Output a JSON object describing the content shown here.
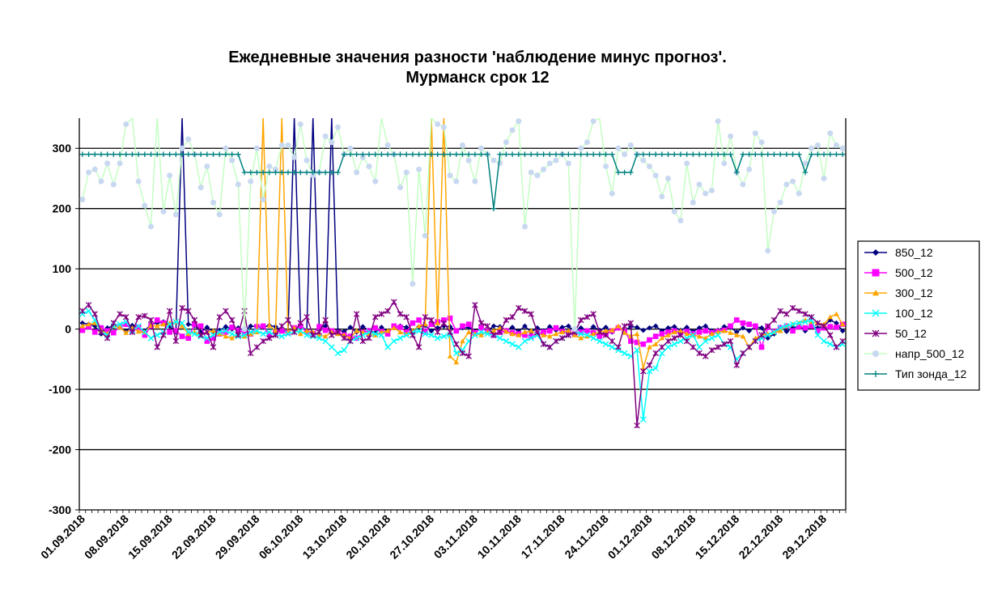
{
  "chart_data": {
    "type": "line",
    "title": [
      "Ежедневные значения разности 'наблюдение минус прогноз'.",
      "Мурманск     срок 12"
    ],
    "xlabel": "",
    "ylabel": "",
    "ylim": [
      -300,
      350
    ],
    "yticks": [
      -300,
      -200,
      -100,
      0,
      100,
      200,
      300
    ],
    "x_start": "2018-09-01",
    "n_days": 123,
    "xtick_labels": [
      "01.09.2018",
      "08.09.2018",
      "15.09.2018",
      "22.09.2018",
      "29.09.2018",
      "06.10.2018",
      "13.10.2018",
      "20.10.2018",
      "27.10.2018",
      "03.11.2018",
      "10.11.2018",
      "17.11.2018",
      "24.11.2018",
      "01.12.2018",
      "08.12.2018",
      "15.12.2018",
      "22.12.2018",
      "29.12.2018"
    ],
    "grid": "horizontal",
    "legend_position": "right",
    "series": [
      {
        "name": "850_12",
        "color": "#000080",
        "marker": "diamond",
        "values": [
          10,
          8,
          5,
          -8,
          2,
          5,
          3,
          -4,
          6,
          2,
          -3,
          8,
          10,
          12,
          5,
          -5,
          350,
          8,
          6,
          -5,
          3,
          -4,
          -2,
          4,
          0,
          2,
          -3,
          5,
          4,
          3,
          6,
          4,
          -2,
          -4,
          350,
          6,
          -3,
          350,
          2,
          5,
          350,
          -2,
          -4,
          3,
          -5,
          4,
          -2,
          -6,
          3,
          -4,
          2,
          5,
          3,
          -5,
          4,
          6,
          -3,
          2,
          5,
          4,
          -3,
          2,
          3,
          -4,
          2,
          -3,
          5,
          4,
          -2,
          3,
          -4,
          5,
          -5,
          2,
          -3,
          4,
          -2,
          3,
          5,
          -4,
          2,
          -3,
          4,
          -2,
          3,
          -5,
          2,
          -3,
          4,
          3,
          -2,
          2,
          5,
          -3,
          2,
          4,
          -2,
          3,
          -4,
          2,
          5,
          -3,
          -2,
          4,
          3,
          -5,
          2,
          -3,
          4,
          2,
          -15,
          -8,
          3,
          -4,
          2,
          5,
          -3,
          4,
          2,
          5,
          15,
          10,
          -3
        ]
      },
      {
        "name": "500_12",
        "color": "#FF00FF",
        "marker": "square",
        "values": [
          -2,
          4,
          -5,
          2,
          -3,
          -6,
          4,
          8,
          -2,
          3,
          -10,
          5,
          15,
          10,
          -5,
          -3,
          -12,
          -15,
          8,
          5,
          -20,
          -15,
          -8,
          -5,
          3,
          -2,
          -6,
          -8,
          4,
          5,
          -10,
          -5,
          -3,
          -6,
          2,
          5,
          -5,
          -8,
          4,
          -2,
          -3,
          -6,
          -10,
          -12,
          -15,
          -5,
          -3,
          2,
          -4,
          -8,
          5,
          3,
          -5,
          10,
          15,
          -4,
          8,
          12,
          15,
          18,
          -3,
          5,
          8,
          -6,
          2,
          -4,
          -10,
          -5,
          -3,
          -6,
          -8,
          -10,
          -12,
          -8,
          -5,
          -3,
          2,
          -4,
          -6,
          -8,
          -5,
          -3,
          -6,
          -12,
          -8,
          -3,
          2,
          -4,
          -20,
          -22,
          -25,
          -18,
          -12,
          -8,
          -5,
          -3,
          -6,
          -4,
          -8,
          -5,
          -3,
          -6,
          -4,
          -2,
          5,
          15,
          10,
          8,
          5,
          -30,
          3,
          -4,
          2,
          5,
          -3,
          4,
          2,
          5,
          -3,
          2,
          4,
          3,
          8,
          5,
          8
        ]
      },
      {
        "name": "300_12",
        "color": "#FFA500",
        "marker": "triangle",
        "values": [
          5,
          8,
          10,
          -2,
          -8,
          5,
          3,
          -6,
          2,
          -4,
          -5,
          6,
          5,
          8,
          10,
          12,
          5,
          -8,
          -5,
          -10,
          -5,
          -3,
          -8,
          -12,
          -15,
          -10,
          -12,
          -8,
          -5,
          350,
          6,
          -3,
          350,
          -5,
          2,
          -8,
          -3,
          -5,
          -10,
          -12,
          -5,
          -8,
          -10,
          -15,
          -3,
          -5,
          -8,
          -10,
          -5,
          -3,
          2,
          -5,
          -8,
          -3,
          5,
          8,
          350,
          10,
          350,
          -45,
          -55,
          -20,
          -5,
          -8,
          -10,
          -5,
          -3,
          2,
          -4,
          -8,
          -10,
          -5,
          -3,
          -8,
          -10,
          -12,
          -8,
          -5,
          -3,
          -10,
          -15,
          -12,
          -8,
          -5,
          -3,
          -2,
          5,
          -6,
          -12,
          -8,
          -65,
          -30,
          -25,
          -15,
          -10,
          -5,
          -3,
          -8,
          -10,
          -12,
          -15,
          -8,
          -5,
          -3,
          -6,
          -10,
          -12,
          -30,
          -15,
          -10,
          -8,
          -5,
          -3,
          5,
          8,
          10,
          15,
          12,
          10,
          8,
          20,
          25,
          8
        ]
      },
      {
        "name": "100_12",
        "color": "#00FFFF",
        "marker": "x",
        "values": [
          25,
          30,
          15,
          -5,
          -10,
          5,
          8,
          12,
          -3,
          5,
          -5,
          -15,
          -10,
          -5,
          8,
          12,
          10,
          -5,
          -8,
          -12,
          -15,
          -10,
          -5,
          -3,
          -8,
          -12,
          -10,
          -5,
          -3,
          -8,
          -5,
          -10,
          -12,
          -8,
          -5,
          -3,
          -10,
          -12,
          -15,
          -20,
          -30,
          -40,
          -35,
          -20,
          -15,
          -10,
          -5,
          -8,
          -10,
          -30,
          -20,
          -15,
          -10,
          -5,
          -3,
          -8,
          -10,
          -15,
          -12,
          -10,
          -40,
          -35,
          -20,
          -10,
          -5,
          -8,
          -10,
          -15,
          -20,
          -25,
          -30,
          -20,
          -15,
          -10,
          -25,
          -30,
          -20,
          -15,
          -10,
          -5,
          -8,
          -10,
          -15,
          -20,
          -25,
          -30,
          -35,
          -40,
          -45,
          -35,
          -150,
          -70,
          -65,
          -40,
          -30,
          -25,
          -20,
          -15,
          -10,
          -30,
          -20,
          -15,
          -10,
          -25,
          -30,
          -50,
          -40,
          -30,
          -20,
          -15,
          -10,
          -5,
          2,
          5,
          8,
          10,
          12,
          15,
          -10,
          -20,
          -25,
          -30,
          -25
        ]
      },
      {
        "name": "50_12",
        "color": "#800080",
        "marker": "star",
        "values": [
          30,
          40,
          25,
          -5,
          -15,
          10,
          25,
          20,
          -5,
          20,
          22,
          15,
          -30,
          -10,
          30,
          -20,
          35,
          30,
          15,
          -10,
          -5,
          -30,
          20,
          30,
          15,
          -10,
          30,
          -40,
          -30,
          -20,
          -15,
          -10,
          5,
          15,
          -5,
          10,
          20,
          -10,
          -5,
          15,
          -10,
          -5,
          -15,
          -20,
          25,
          -20,
          -15,
          20,
          25,
          30,
          45,
          25,
          20,
          -10,
          -30,
          20,
          15,
          -5,
          10,
          -5,
          -25,
          -40,
          -45,
          40,
          10,
          5,
          -10,
          -5,
          15,
          20,
          35,
          30,
          25,
          -5,
          -25,
          -30,
          -20,
          -15,
          -10,
          -5,
          15,
          20,
          25,
          -5,
          -10,
          -20,
          -30,
          5,
          10,
          -160,
          -70,
          -60,
          -40,
          -30,
          -20,
          -15,
          -10,
          -20,
          -30,
          -40,
          -45,
          -35,
          -30,
          -25,
          -20,
          -60,
          -40,
          -30,
          -20,
          -10,
          5,
          15,
          30,
          25,
          35,
          30,
          25,
          20,
          10,
          5,
          -10,
          -30,
          -20
        ]
      },
      {
        "name": "напр_500_12",
        "color": "#C0FFC0",
        "marker": "circle",
        "marker_color": "#C8D8F0",
        "values": [
          215,
          260,
          265,
          245,
          275,
          240,
          275,
          340,
          350,
          245,
          205,
          170,
          350,
          195,
          255,
          190,
          300,
          315,
          290,
          235,
          270,
          210,
          190,
          300,
          280,
          240,
          0,
          245,
          300,
          215,
          270,
          265,
          305,
          305,
          285,
          340,
          280,
          255,
          260,
          320,
          310,
          335,
          290,
          300,
          260,
          285,
          270,
          245,
          350,
          305,
          290,
          235,
          260,
          75,
          265,
          155,
          350,
          340,
          335,
          255,
          245,
          305,
          280,
          245,
          300,
          290,
          280,
          275,
          310,
          330,
          345,
          170,
          260,
          255,
          265,
          275,
          280,
          290,
          275,
          0,
          300,
          310,
          345,
          350,
          270,
          225,
          300,
          290,
          305,
          290,
          280,
          270,
          255,
          220,
          250,
          195,
          180,
          275,
          210,
          240,
          225,
          230,
          345,
          275,
          320,
          260,
          240,
          265,
          325,
          310,
          130,
          195,
          210,
          240,
          245,
          225,
          275,
          300,
          305,
          250,
          325,
          305,
          300
        ]
      },
      {
        "name": "Тип зонда_12",
        "color": "#008080",
        "marker": "plus",
        "values": [
          290,
          290,
          290,
          290,
          290,
          290,
          290,
          290,
          290,
          290,
          290,
          290,
          290,
          290,
          290,
          290,
          290,
          290,
          290,
          290,
          290,
          290,
          290,
          290,
          290,
          290,
          260,
          260,
          260,
          260,
          260,
          260,
          260,
          260,
          260,
          260,
          260,
          260,
          260,
          260,
          260,
          260,
          290,
          290,
          290,
          290,
          290,
          290,
          290,
          290,
          290,
          290,
          290,
          290,
          290,
          290,
          290,
          290,
          290,
          290,
          290,
          290,
          290,
          290,
          290,
          290,
          200,
          290,
          290,
          290,
          290,
          290,
          290,
          290,
          290,
          290,
          290,
          290,
          290,
          290,
          290,
          290,
          290,
          290,
          290,
          290,
          260,
          260,
          260,
          290,
          290,
          290,
          290,
          290,
          290,
          290,
          290,
          290,
          290,
          290,
          290,
          290,
          290,
          290,
          290,
          260,
          290,
          290,
          290,
          290,
          290,
          290,
          290,
          290,
          290,
          290,
          260,
          290,
          290,
          290,
          290,
          290,
          290
        ]
      }
    ]
  }
}
